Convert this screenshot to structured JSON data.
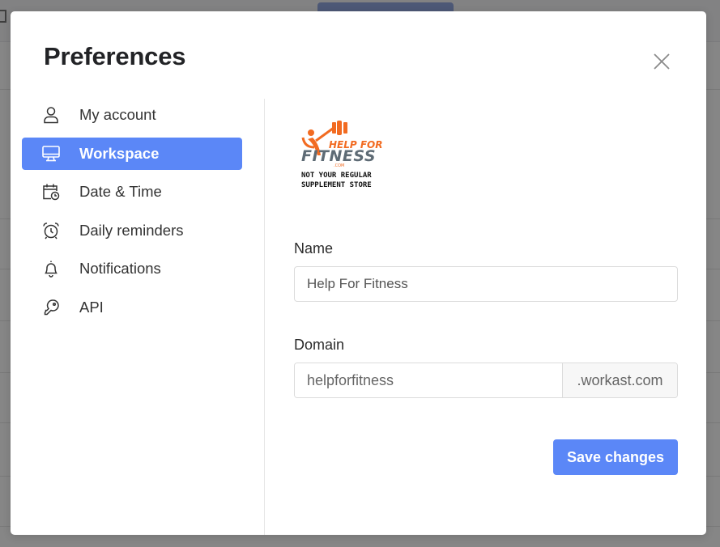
{
  "modal": {
    "title": "Preferences",
    "close_icon": "close-icon"
  },
  "sidebar": {
    "items": [
      {
        "label": "My account",
        "icon": "user-icon",
        "active": false
      },
      {
        "label": "Workspace",
        "icon": "monitor-icon",
        "active": true
      },
      {
        "label": "Date & Time",
        "icon": "calendar-clock-icon",
        "active": false
      },
      {
        "label": "Daily reminders",
        "icon": "alarm-clock-icon",
        "active": false
      },
      {
        "label": "Notifications",
        "icon": "bell-icon",
        "active": false
      },
      {
        "label": "API",
        "icon": "key-icon",
        "active": false
      }
    ]
  },
  "workspace": {
    "logo": {
      "line1": "HELP FOR",
      "line2": "FITNESS",
      "dotcom": ".COM",
      "tagline1": "NOT YOUR REGULAR",
      "tagline2": "SUPPLEMENT STORE"
    },
    "name_label": "Name",
    "name_value": "Help For Fitness",
    "domain_label": "Domain",
    "domain_value": "helpforfitness",
    "domain_suffix": ".workast.com",
    "save_label": "Save changes"
  },
  "colors": {
    "accent": "#5b87f7",
    "logo_orange": "#f26b21",
    "logo_gray": "#5e6b75"
  }
}
